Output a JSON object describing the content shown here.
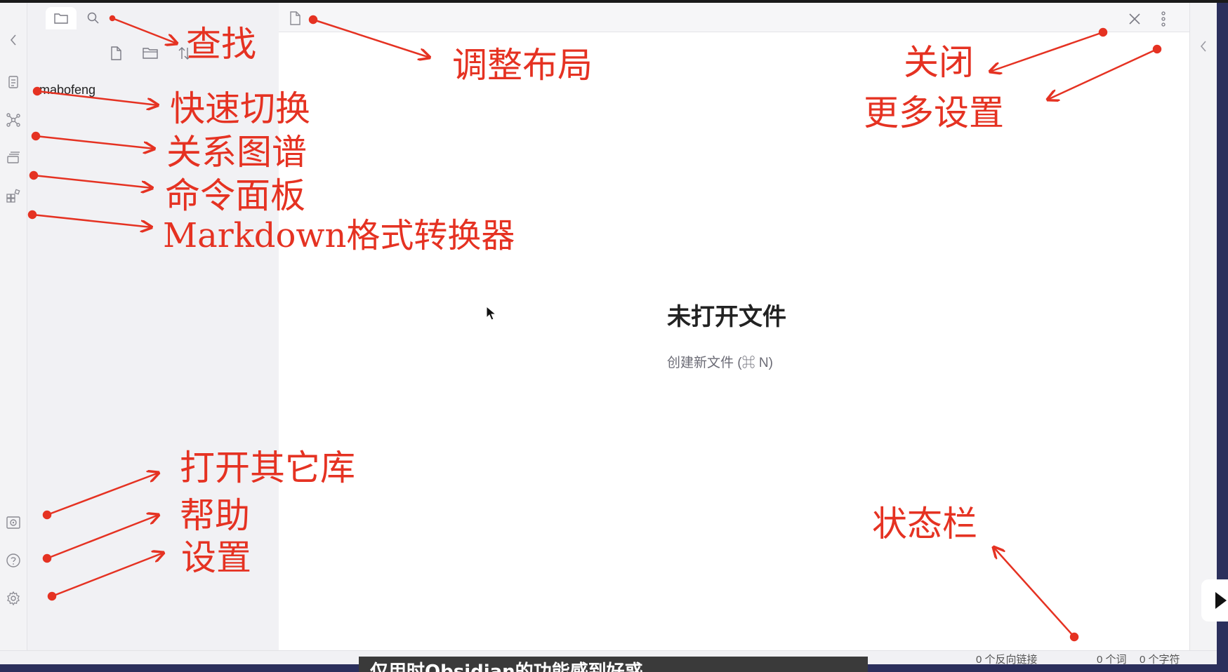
{
  "vault": {
    "name": "mabofeng"
  },
  "main": {
    "empty_title": "未打开文件",
    "empty_action": "创建新文件 (⌘ N)"
  },
  "statusbar": {
    "backlinks": "0 个反向链接",
    "words": "0 个词",
    "chars": "0 个字符"
  },
  "annotations": {
    "search": "查找",
    "layout": "调整布局",
    "close": "关闭",
    "more_settings": "更多设置",
    "quick_switch": "快速切换",
    "graph": "关系图谱",
    "command_palette": "命令面板",
    "markdown_converter": "Markdown格式转换器",
    "open_vault": "打开其它库",
    "help": "帮助",
    "settings": "设置",
    "status_bar": "状态栏"
  },
  "subtitle": {
    "text": "仅用时Obsidian的功能感到好惑"
  },
  "icons": {
    "ribbon_collapse": "chevron-left-icon",
    "quick_switch": "file-search-icon",
    "graph": "graph-icon",
    "command_palette": "command-layers-icon",
    "markdown_converter": "blocks-icon",
    "open_vault": "vault-icon",
    "help": "help-circle-icon",
    "settings": "gear-icon",
    "files_tab": "folder-icon",
    "search_tab": "search-icon",
    "new_note": "new-file-icon",
    "new_folder": "new-folder-icon",
    "sort": "sort-icon",
    "tab_file": "file-icon",
    "close": "close-icon",
    "more": "more-vertical-icon",
    "right_collapse": "chevron-left-icon"
  },
  "colors": {
    "annotation": "#e53222",
    "sidebar_bg": "#f1f1f4",
    "main_bg": "#ffffff",
    "desktop_bg": "#2b2f5c"
  }
}
